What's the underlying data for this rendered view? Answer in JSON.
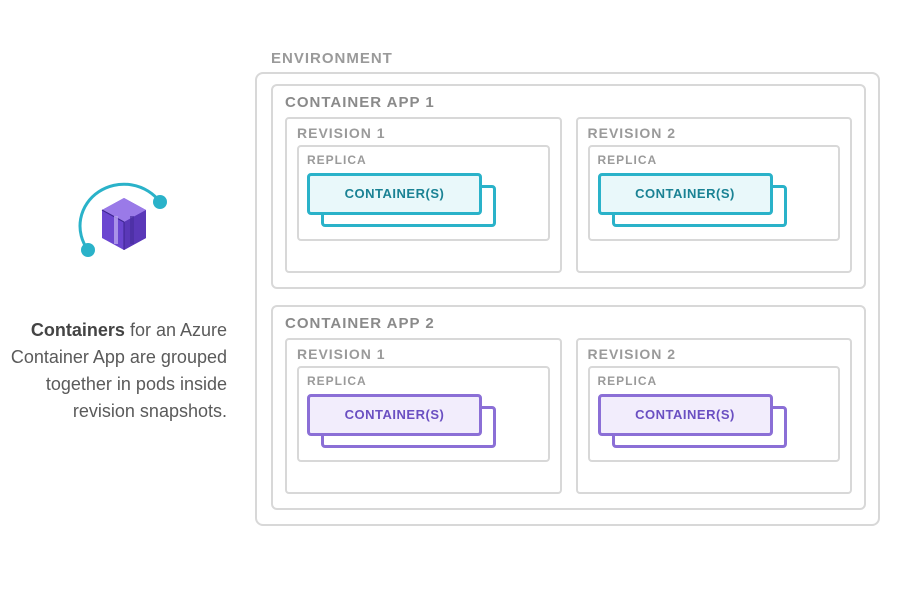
{
  "colors": {
    "teal": "#2ab2c9",
    "purple": "#8b6fd6",
    "grey_border": "#d8d8d8"
  },
  "caption": {
    "bold": "Containers",
    "rest": " for an Azure Container App are grouped together in pods inside revision snapshots."
  },
  "diagram": {
    "env_label": "ENVIRONMENT",
    "apps": [
      {
        "label": "CONTAINER APP 1",
        "color": "teal",
        "revisions": [
          {
            "label": "REVISION 1",
            "replica_label": "REPLICA",
            "container_label": "CONTAINER(S)"
          },
          {
            "label": "REVISION 2",
            "replica_label": "REPLICA",
            "container_label": "CONTAINER(S)"
          }
        ]
      },
      {
        "label": "CONTAINER APP 2",
        "color": "purple",
        "revisions": [
          {
            "label": "REVISION 1",
            "replica_label": "REPLICA",
            "container_label": "CONTAINER(S)"
          },
          {
            "label": "REVISION 2",
            "replica_label": "REPLICA",
            "container_label": "CONTAINER(S)"
          }
        ]
      }
    ]
  },
  "icon_name": "azure-container-apps-icon"
}
